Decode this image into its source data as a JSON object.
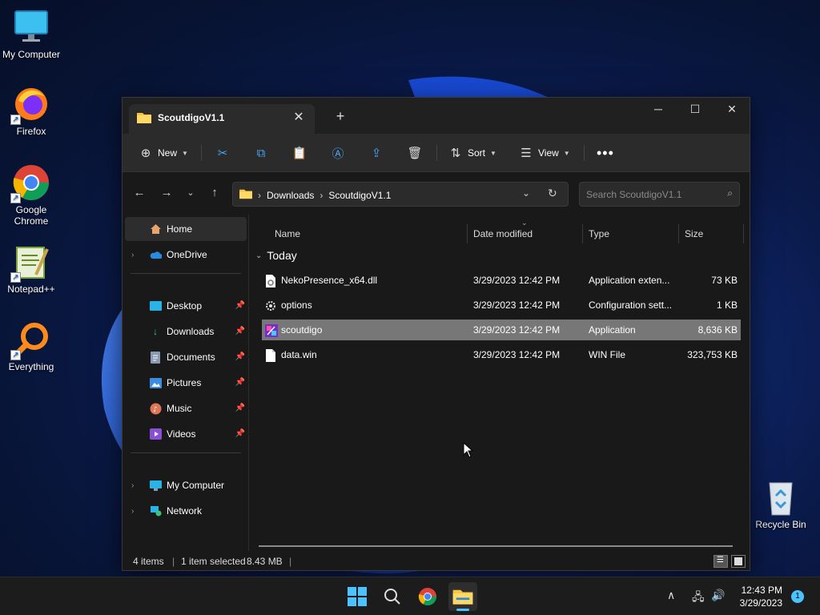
{
  "desktop": {
    "icons": [
      {
        "label": "My Computer",
        "icon": "monitor-icon"
      },
      {
        "label": "Firefox",
        "icon": "firefox-icon"
      },
      {
        "label": "Google Chrome",
        "icon": "chrome-icon"
      },
      {
        "label": "Notepad++",
        "icon": "notepadpp-icon"
      },
      {
        "label": "Everything",
        "icon": "everything-icon"
      },
      {
        "label": "Recycle Bin",
        "icon": "recycle-bin-icon"
      }
    ]
  },
  "window": {
    "tab_title": "ScoutdigoV1.1",
    "toolbar": {
      "new": "New",
      "sort": "Sort",
      "view": "View"
    },
    "breadcrumb": [
      "Downloads",
      "ScoutdigoV1.1"
    ],
    "search_placeholder": "Search ScoutdigoV1.1",
    "sidebar": {
      "home": "Home",
      "onedrive": "OneDrive",
      "quick": [
        "Desktop",
        "Downloads",
        "Documents",
        "Pictures",
        "Music",
        "Videos"
      ],
      "my_computer": "My Computer",
      "network": "Network"
    },
    "columns": {
      "name": "Name",
      "date": "Date modified",
      "type": "Type",
      "size": "Size"
    },
    "group": "Today",
    "files": [
      {
        "name": "NekoPresence_x64.dll",
        "date": "3/29/2023 12:42 PM",
        "type": "Application exten...",
        "size": "73 KB",
        "icon": "dll-file-icon",
        "selected": false
      },
      {
        "name": "options",
        "date": "3/29/2023 12:42 PM",
        "type": "Configuration sett...",
        "size": "1 KB",
        "icon": "config-file-icon",
        "selected": false
      },
      {
        "name": "scoutdigo",
        "date": "3/29/2023 12:42 PM",
        "type": "Application",
        "size": "8,636 KB",
        "icon": "app-icon",
        "selected": true
      },
      {
        "name": "data.win",
        "date": "3/29/2023 12:42 PM",
        "type": "WIN File",
        "size": "323,753 KB",
        "icon": "file-icon",
        "selected": false
      }
    ],
    "status": {
      "items": "4 items",
      "selected": "1 item selected",
      "size": "8.43 MB"
    }
  },
  "taskbar": {
    "time": "12:43 PM",
    "date": "3/29/2023",
    "notifications": "1"
  },
  "colors": {
    "accent": "#4cc2ff",
    "folder": "#f5c542",
    "selection": "#777777"
  }
}
